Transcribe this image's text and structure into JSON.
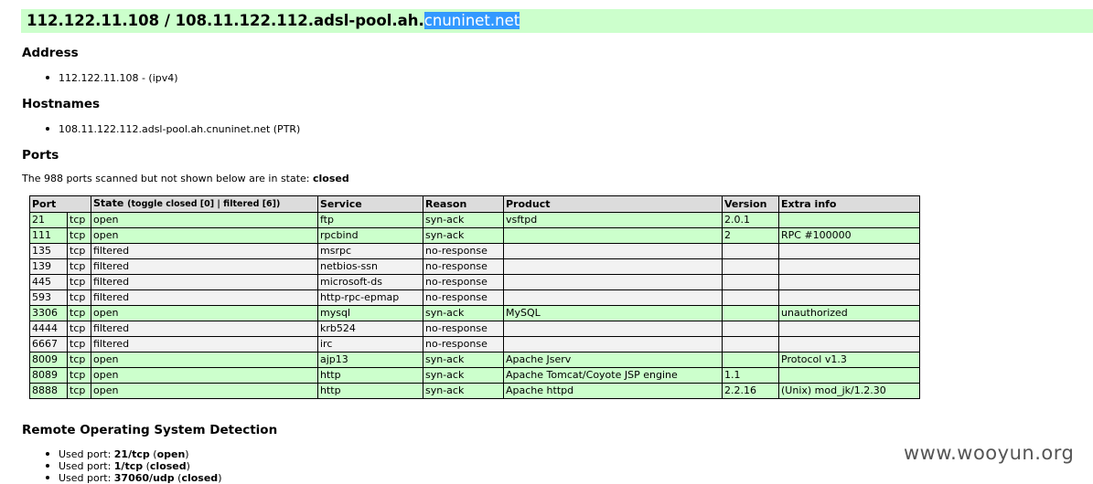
{
  "title": {
    "prefix": "112.122.11.108 / 108.11.122.112.adsl-pool.ah.",
    "selected": "cnuninet.net"
  },
  "address": {
    "heading": "Address",
    "items": [
      "112.122.11.108 - (ipv4)"
    ]
  },
  "hostnames": {
    "heading": "Hostnames",
    "items": [
      "108.11.122.112.adsl-pool.ah.cnuninet.net (PTR)"
    ]
  },
  "ports": {
    "heading": "Ports",
    "note_prefix": "The 988 ports scanned but not shown below are in state: ",
    "note_state": "closed",
    "columns": {
      "port": "Port",
      "state": "State",
      "state_toggle": "(toggle closed [0] | filtered [6])",
      "service": "Service",
      "reason": "Reason",
      "product": "Product",
      "version": "Version",
      "extra": "Extra info"
    },
    "rows": [
      {
        "port": "21",
        "proto": "tcp",
        "state": "open",
        "service": "ftp",
        "reason": "syn-ack",
        "product": "vsftpd",
        "version": "2.0.1",
        "extra": ""
      },
      {
        "port": "111",
        "proto": "tcp",
        "state": "open",
        "service": "rpcbind",
        "reason": "syn-ack",
        "product": "",
        "version": "2",
        "extra": "RPC #100000"
      },
      {
        "port": "135",
        "proto": "tcp",
        "state": "filtered",
        "service": "msrpc",
        "reason": "no-response",
        "product": "",
        "version": "",
        "extra": ""
      },
      {
        "port": "139",
        "proto": "tcp",
        "state": "filtered",
        "service": "netbios-ssn",
        "reason": "no-response",
        "product": "",
        "version": "",
        "extra": ""
      },
      {
        "port": "445",
        "proto": "tcp",
        "state": "filtered",
        "service": "microsoft-ds",
        "reason": "no-response",
        "product": "",
        "version": "",
        "extra": ""
      },
      {
        "port": "593",
        "proto": "tcp",
        "state": "filtered",
        "service": "http-rpc-epmap",
        "reason": "no-response",
        "product": "",
        "version": "",
        "extra": ""
      },
      {
        "port": "3306",
        "proto": "tcp",
        "state": "open",
        "service": "mysql",
        "reason": "syn-ack",
        "product": "MySQL",
        "version": "",
        "extra": "unauthorized"
      },
      {
        "port": "4444",
        "proto": "tcp",
        "state": "filtered",
        "service": "krb524",
        "reason": "no-response",
        "product": "",
        "version": "",
        "extra": ""
      },
      {
        "port": "6667",
        "proto": "tcp",
        "state": "filtered",
        "service": "irc",
        "reason": "no-response",
        "product": "",
        "version": "",
        "extra": ""
      },
      {
        "port": "8009",
        "proto": "tcp",
        "state": "open",
        "service": "ajp13",
        "reason": "syn-ack",
        "product": "Apache Jserv",
        "version": "",
        "extra": "Protocol v1.3"
      },
      {
        "port": "8089",
        "proto": "tcp",
        "state": "open",
        "service": "http",
        "reason": "syn-ack",
        "product": "Apache Tomcat/Coyote JSP engine",
        "version": "1.1",
        "extra": ""
      },
      {
        "port": "8888",
        "proto": "tcp",
        "state": "open",
        "service": "http",
        "reason": "syn-ack",
        "product": "Apache httpd",
        "version": "2.2.16",
        "extra": "(Unix) mod_jk/1.2.30"
      }
    ]
  },
  "os_detection": {
    "heading": "Remote Operating System Detection",
    "used_ports": [
      {
        "label": "Used port: ",
        "port": "21/tcp",
        "state": "open"
      },
      {
        "label": "Used port: ",
        "port": "1/tcp",
        "state": "closed"
      },
      {
        "label": "Used port: ",
        "port": "37060/udp",
        "state": "closed"
      }
    ]
  },
  "watermark": "www.wooyun.org",
  "colors": {
    "open_row": "#ccffcc",
    "filtered_row": "#f2f2f2",
    "header_row": "#dcdcdc",
    "selection": "#3399ff"
  }
}
